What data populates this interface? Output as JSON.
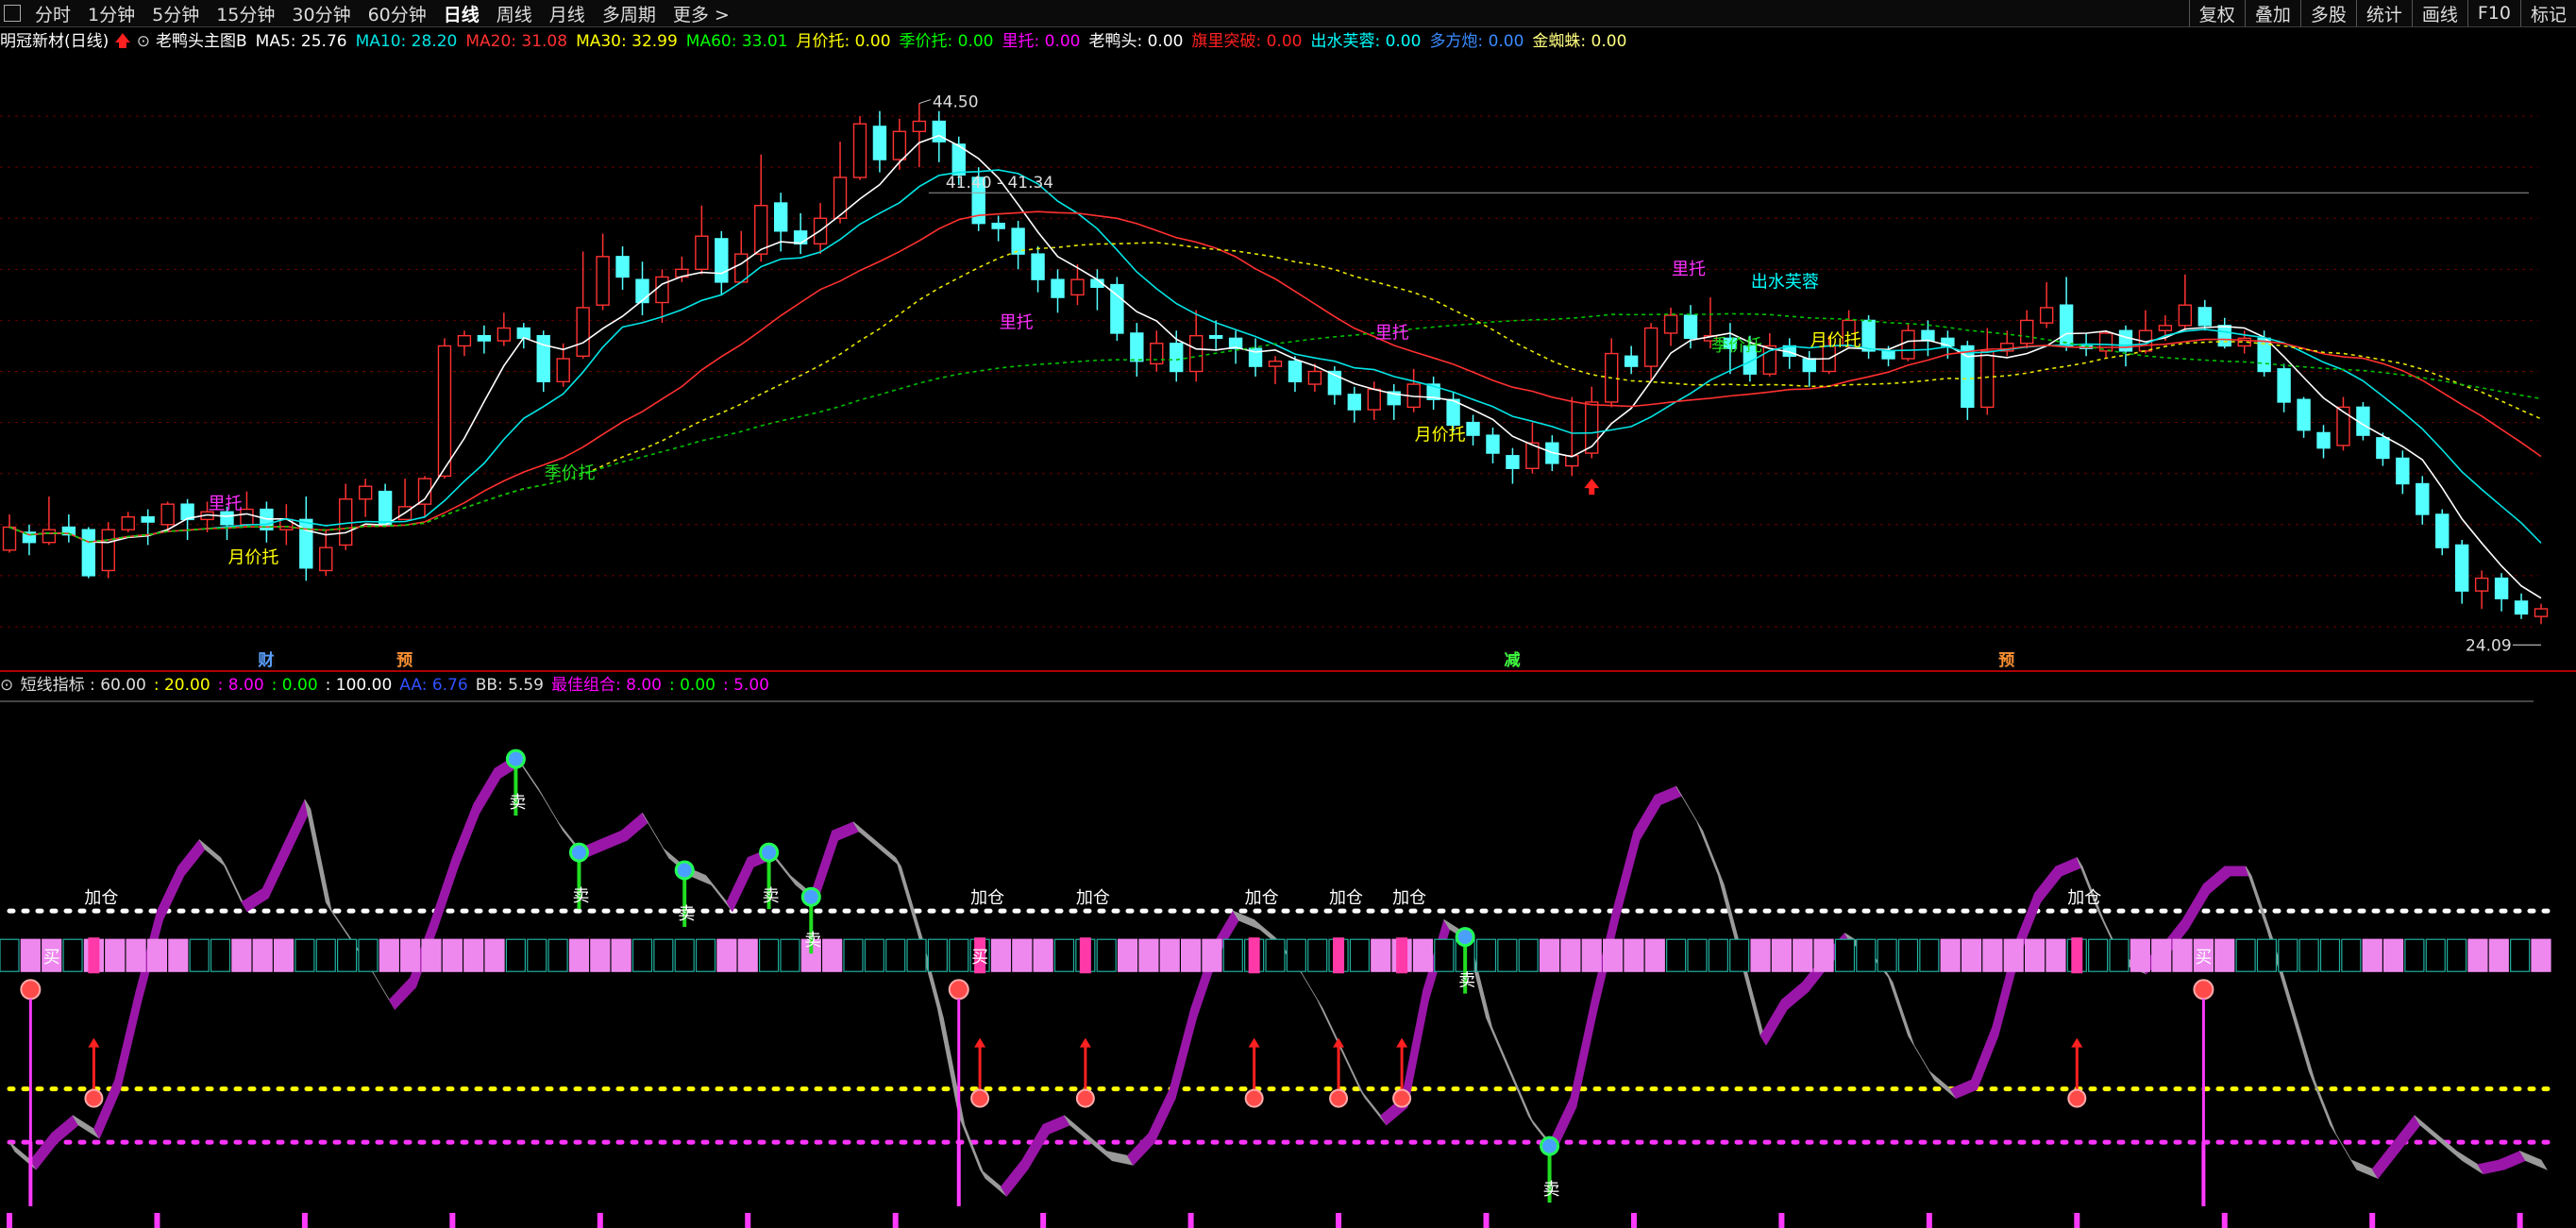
{
  "toolbar": {
    "periods": [
      "分时",
      "1分钟",
      "5分钟",
      "15分钟",
      "30分钟",
      "60分钟",
      "日线",
      "周线",
      "月线",
      "多周期",
      "更多 >"
    ],
    "active_period": "日线",
    "right_buttons": [
      "复权",
      "叠加",
      "多股",
      "统计",
      "画线",
      "F10",
      "标记"
    ]
  },
  "main_legend": {
    "title": "明冠新材(日线)",
    "formula": "老鸭头主图B",
    "items": [
      {
        "label": "MA5: 25.76",
        "color": "#ffffff"
      },
      {
        "label": "MA10: 28.20",
        "color": "#00e5e5"
      },
      {
        "label": "MA20: 31.08",
        "color": "#ff3030"
      },
      {
        "label": "MA30: 32.99",
        "color": "#ffff00"
      },
      {
        "label": "MA60: 33.01",
        "color": "#00ff00"
      },
      {
        "label": "月价托: 0.00",
        "color": "#ffff00"
      },
      {
        "label": "季价托: 0.00",
        "color": "#00ff00"
      },
      {
        "label": "里托: 0.00",
        "color": "#ff00ff"
      },
      {
        "label": "老鸭头: 0.00",
        "color": "#ffffff"
      },
      {
        "label": "旗里突破: 0.00",
        "color": "#ff2020"
      },
      {
        "label": "出水芙蓉: 0.00",
        "color": "#00ffff"
      },
      {
        "label": "多方炮: 0.00",
        "color": "#3a8cff"
      },
      {
        "label": "金蜘蛛: 0.00",
        "color": "#ffff80"
      }
    ]
  },
  "sub_legend": {
    "items": [
      {
        "label": "短线指标 : 60.00",
        "color": "#dddddd"
      },
      {
        "label": ": 20.00",
        "color": "#ffff00"
      },
      {
        "label": ": 8.00",
        "color": "#ff00ff"
      },
      {
        "label": ": 0.00",
        "color": "#00ff00"
      },
      {
        "label": ": 100.00",
        "color": "#ffffff"
      },
      {
        "label": "AA: 6.76",
        "color": "#3050ff"
      },
      {
        "label": "BB: 5.59",
        "color": "#dddddd"
      },
      {
        "label": "最佳组合: 8.00",
        "color": "#ff00ff"
      },
      {
        "label": ": 0.00",
        "color": "#00ff00"
      },
      {
        "label": ": 5.00",
        "color": "#ff00ff"
      }
    ]
  },
  "price_labels": {
    "high": "44.50",
    "level": "41.40 - 41.34",
    "low": "24.09"
  },
  "bottom_markers": [
    {
      "text": "财",
      "color": "#5aa0ff",
      "bar": 13
    },
    {
      "text": "预",
      "color": "#ff9030",
      "bar": 20
    },
    {
      "text": "减",
      "color": "#40ff40",
      "bar": 76
    },
    {
      "text": "预",
      "color": "#ff9030",
      "bar": 101
    }
  ],
  "chart_labels": [
    {
      "text": "里托",
      "color": "#ff30ff",
      "bar": 11,
      "price": 28.6
    },
    {
      "text": "月价托",
      "color": "#ffff00",
      "bar": 12,
      "price": 26.5
    },
    {
      "text": "季价托",
      "color": "#20e020",
      "bar": 28,
      "price": 29.8
    },
    {
      "text": "里托",
      "color": "#ff30ff",
      "bar": 51,
      "price": 35.7
    },
    {
      "text": "里托",
      "color": "#ff30ff",
      "bar": 70,
      "price": 35.3
    },
    {
      "text": "月价托",
      "color": "#ffff00",
      "bar": 72,
      "price": 31.3
    },
    {
      "text": "里托",
      "color": "#ff30ff",
      "bar": 85,
      "price": 37.8
    },
    {
      "text": "出水芙蓉",
      "color": "#00ffff",
      "bar": 89,
      "price": 37.3
    },
    {
      "text": "季价托",
      "color": "#20e020",
      "bar": 87,
      "price": 34.8
    },
    {
      "text": "月价托",
      "color": "#ffff00",
      "bar": 92,
      "price": 35.0
    }
  ],
  "chart_data": {
    "type": "candlestick",
    "ylim": [
      23,
      46
    ],
    "candles": [
      [
        27.0,
        27.9,
        28.4,
        26.9
      ],
      [
        27.7,
        27.3,
        28.0,
        26.8
      ],
      [
        27.3,
        27.8,
        29.1,
        27.2
      ],
      [
        27.9,
        27.6,
        28.4,
        27.3
      ],
      [
        27.8,
        26.0,
        27.9,
        25.9
      ],
      [
        26.2,
        27.8,
        28.1,
        25.9
      ],
      [
        27.8,
        28.3,
        28.5,
        27.7
      ],
      [
        28.3,
        28.1,
        28.6,
        27.2
      ],
      [
        28.0,
        28.8,
        28.9,
        27.7
      ],
      [
        28.8,
        28.2,
        29.0,
        27.4
      ],
      [
        28.2,
        28.5,
        28.9,
        27.7
      ],
      [
        28.5,
        28.0,
        28.7,
        27.4
      ],
      [
        28.0,
        28.6,
        29.3,
        27.9
      ],
      [
        28.6,
        27.8,
        28.9,
        27.3
      ],
      [
        27.8,
        28.2,
        28.8,
        27.2
      ],
      [
        28.2,
        26.3,
        29.1,
        25.8
      ],
      [
        26.2,
        27.1,
        27.8,
        26.0
      ],
      [
        27.2,
        29.0,
        29.6,
        27.0
      ],
      [
        29.0,
        29.5,
        29.8,
        28.3
      ],
      [
        29.3,
        28.0,
        29.6,
        27.9
      ],
      [
        28.2,
        28.7,
        29.8,
        28.2
      ],
      [
        28.8,
        29.8,
        29.9,
        28.3
      ],
      [
        29.9,
        35.0,
        35.3,
        29.8
      ],
      [
        35.0,
        35.4,
        35.6,
        34.6
      ],
      [
        35.4,
        35.2,
        35.8,
        34.7
      ],
      [
        35.2,
        35.7,
        36.3,
        35.0
      ],
      [
        35.7,
        35.3,
        35.9,
        34.9
      ],
      [
        35.4,
        33.6,
        35.6,
        33.2
      ],
      [
        33.6,
        34.5,
        35.1,
        33.4
      ],
      [
        34.6,
        36.5,
        38.7,
        34.5
      ],
      [
        36.6,
        38.5,
        39.4,
        36.4
      ],
      [
        38.5,
        37.7,
        38.9,
        37.2
      ],
      [
        37.6,
        36.7,
        38.3,
        36.2
      ],
      [
        36.7,
        37.7,
        38.0,
        35.9
      ],
      [
        37.7,
        38.0,
        38.5,
        37.5
      ],
      [
        38.0,
        39.3,
        40.5,
        37.8
      ],
      [
        39.2,
        37.5,
        39.5,
        37.0
      ],
      [
        37.5,
        38.6,
        39.5,
        37.5
      ],
      [
        38.6,
        40.5,
        42.5,
        38.3
      ],
      [
        40.6,
        39.5,
        41.0,
        38.7
      ],
      [
        39.5,
        39.0,
        40.2,
        38.6
      ],
      [
        39.0,
        40.0,
        40.6,
        38.6
      ],
      [
        40.0,
        41.6,
        43.0,
        39.8
      ],
      [
        41.6,
        43.7,
        44.0,
        41.5
      ],
      [
        43.6,
        42.3,
        44.2,
        41.8
      ],
      [
        42.3,
        43.4,
        43.9,
        41.9
      ],
      [
        43.4,
        43.8,
        44.5,
        42.0
      ],
      [
        43.8,
        43.0,
        44.2,
        42.2
      ],
      [
        42.9,
        41.7,
        43.2,
        41.3
      ],
      [
        41.6,
        39.8,
        42.0,
        39.5
      ],
      [
        39.8,
        39.6,
        40.1,
        39.1
      ],
      [
        39.6,
        38.6,
        39.9,
        38.0
      ],
      [
        38.6,
        37.6,
        38.9,
        37.1
      ],
      [
        37.6,
        36.9,
        38.0,
        36.3
      ],
      [
        37.0,
        37.6,
        38.2,
        36.6
      ],
      [
        37.6,
        37.3,
        38.0,
        36.4
      ],
      [
        37.4,
        35.5,
        37.7,
        35.2
      ],
      [
        35.5,
        34.4,
        35.9,
        33.8
      ],
      [
        34.3,
        35.1,
        35.6,
        34.0
      ],
      [
        35.1,
        34.0,
        35.6,
        33.6
      ],
      [
        34.0,
        35.4,
        36.4,
        33.6
      ],
      [
        35.4,
        35.3,
        36.0,
        34.8
      ],
      [
        35.3,
        34.9,
        35.6,
        34.3
      ],
      [
        34.9,
        34.2,
        35.3,
        33.8
      ],
      [
        34.2,
        34.4,
        34.6,
        33.5
      ],
      [
        34.4,
        33.6,
        34.6,
        33.2
      ],
      [
        33.5,
        34.0,
        34.3,
        33.2
      ],
      [
        34.0,
        33.1,
        34.2,
        32.7
      ],
      [
        33.1,
        32.5,
        33.4,
        32.0
      ],
      [
        32.5,
        33.3,
        33.6,
        32.1
      ],
      [
        33.2,
        32.7,
        33.5,
        32.1
      ],
      [
        32.6,
        33.5,
        34.1,
        32.4
      ],
      [
        33.5,
        32.9,
        33.8,
        32.5
      ],
      [
        32.9,
        31.9,
        33.2,
        31.6
      ],
      [
        32.0,
        31.5,
        32.3,
        31.1
      ],
      [
        31.5,
        30.8,
        31.8,
        30.4
      ],
      [
        30.7,
        30.2,
        31.0,
        29.6
      ],
      [
        30.2,
        31.2,
        32.0,
        30.0
      ],
      [
        31.2,
        30.4,
        31.5,
        30.1
      ],
      [
        30.3,
        30.7,
        33.0,
        29.9
      ],
      [
        30.8,
        32.8,
        33.4,
        30.6
      ],
      [
        32.8,
        34.7,
        35.3,
        32.6
      ],
      [
        34.6,
        34.2,
        35.0,
        33.9
      ],
      [
        34.2,
        35.7,
        35.9,
        33.6
      ],
      [
        35.5,
        36.2,
        36.5,
        35.0
      ],
      [
        36.2,
        35.3,
        36.6,
        34.9
      ],
      [
        35.2,
        35.4,
        36.9,
        34.9
      ],
      [
        35.3,
        34.9,
        35.9,
        33.9
      ],
      [
        35.0,
        33.9,
        35.4,
        33.6
      ],
      [
        33.9,
        35.0,
        35.5,
        33.8
      ],
      [
        35.0,
        34.6,
        35.3,
        34.1
      ],
      [
        34.5,
        34.0,
        34.8,
        33.4
      ],
      [
        34.0,
        35.0,
        35.4,
        33.9
      ],
      [
        35.0,
        36.0,
        36.4,
        34.9
      ],
      [
        36.0,
        34.8,
        36.2,
        34.5
      ],
      [
        34.8,
        34.5,
        35.0,
        34.2
      ],
      [
        34.5,
        35.6,
        35.9,
        34.4
      ],
      [
        35.6,
        35.2,
        36.0,
        34.6
      ],
      [
        35.3,
        35.0,
        35.6,
        34.5
      ],
      [
        35.0,
        32.6,
        35.2,
        32.1
      ],
      [
        32.6,
        34.8,
        35.7,
        32.3
      ],
      [
        34.8,
        35.1,
        35.6,
        34.6
      ],
      [
        35.1,
        36.0,
        36.4,
        34.9
      ],
      [
        35.9,
        36.5,
        37.5,
        35.7
      ],
      [
        36.6,
        35.0,
        37.7,
        34.8
      ],
      [
        35.0,
        34.9,
        35.5,
        34.6
      ],
      [
        34.8,
        35.5,
        35.6,
        34.5
      ],
      [
        35.6,
        34.8,
        35.8,
        34.2
      ],
      [
        34.8,
        35.6,
        36.4,
        34.7
      ],
      [
        35.6,
        35.8,
        36.2,
        35.2
      ],
      [
        35.8,
        36.6,
        37.8,
        35.6
      ],
      [
        36.5,
        35.8,
        36.8,
        35.6
      ],
      [
        35.8,
        35.0,
        36.1,
        34.9
      ],
      [
        35.0,
        35.3,
        35.6,
        34.7
      ],
      [
        35.3,
        34.0,
        35.6,
        33.8
      ],
      [
        34.1,
        32.8,
        34.3,
        32.4
      ],
      [
        32.9,
        31.7,
        33.0,
        31.4
      ],
      [
        31.6,
        31.0,
        31.9,
        30.6
      ],
      [
        31.1,
        32.6,
        33.0,
        30.9
      ],
      [
        32.6,
        31.5,
        32.8,
        31.3
      ],
      [
        31.4,
        30.6,
        31.6,
        30.3
      ],
      [
        30.6,
        29.6,
        30.9,
        29.2
      ],
      [
        29.6,
        28.4,
        29.9,
        28.0
      ],
      [
        28.4,
        27.1,
        28.6,
        26.8
      ],
      [
        27.2,
        25.4,
        27.4,
        24.9
      ],
      [
        25.4,
        25.9,
        26.2,
        24.7
      ],
      [
        25.9,
        25.1,
        26.1,
        24.6
      ],
      [
        25.0,
        24.5,
        25.3,
        24.3
      ],
      [
        24.4,
        24.7,
        24.9,
        24.1
      ]
    ],
    "ma": [
      {
        "name": "MA5",
        "color": "#ffffff",
        "period": 5
      },
      {
        "name": "MA10",
        "color": "#00e5e5",
        "period": 10
      },
      {
        "name": "MA20",
        "color": "#ff3030",
        "period": 20
      },
      {
        "name": "MA30",
        "color": "#e6e600",
        "period": 30,
        "dashed": true
      },
      {
        "name": "MA60",
        "color": "#00c000",
        "period": 60,
        "dashed": true
      }
    ],
    "sub_chart": {
      "ylim": [
        -10,
        105
      ],
      "ref_lines": [
        {
          "value": 60,
          "color": "#ffffff"
        },
        {
          "value": 20,
          "color": "#ffff00"
        },
        {
          "value": 8,
          "color": "#ff33ff"
        }
      ],
      "oscillator": [
        8,
        4,
        10,
        14,
        11,
        22,
        42,
        60,
        70,
        76,
        72,
        62,
        65,
        75,
        85,
        62,
        55,
        48,
        40,
        45,
        58,
        72,
        84,
        92,
        95,
        88,
        80,
        74,
        76,
        78,
        82,
        74,
        70,
        68,
        62,
        72,
        74,
        68,
        64,
        78,
        80,
        76,
        72,
        56,
        38,
        14,
        2,
        -2,
        4,
        12,
        14,
        10,
        6,
        5,
        10,
        20,
        38,
        52,
        60,
        58,
        54,
        48,
        40,
        30,
        20,
        14,
        18,
        42,
        58,
        55,
        36,
        25,
        14,
        8,
        18,
        40,
        60,
        78,
        86,
        88,
        80,
        68,
        50,
        32,
        40,
        44,
        50,
        55,
        52,
        46,
        32,
        24,
        20,
        22,
        34,
        52,
        64,
        70,
        72,
        60,
        50,
        48,
        52,
        58,
        66,
        70,
        70,
        56,
        40,
        24,
        12,
        4,
        2,
        8,
        14,
        10,
        6,
        3,
        4,
        6,
        4
      ],
      "square_row_value": 50,
      "signals": {
        "sell_bars": [
          24,
          27,
          32,
          36,
          38,
          69,
          73
        ],
        "add_bars": [
          4,
          46,
          51,
          59,
          63,
          66,
          98
        ],
        "buy_arrow_bars": [
          4,
          46,
          51,
          59,
          63,
          66,
          98
        ],
        "buy_text_bars": [
          2,
          46,
          104
        ]
      },
      "spikes": [
        1,
        45,
        104
      ]
    }
  }
}
